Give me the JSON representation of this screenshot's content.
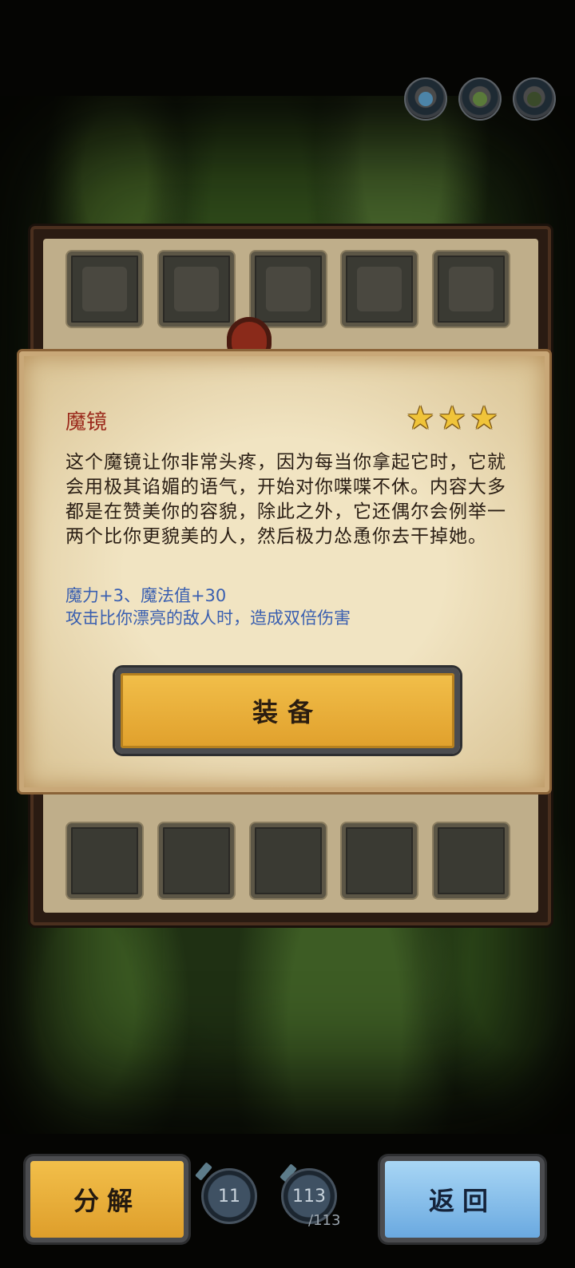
{
  "header": {
    "avatars": [
      {
        "name": "hero-avatar-1",
        "color": "#4c84a8"
      },
      {
        "name": "hero-avatar-2",
        "color": "#5a7a3a"
      },
      {
        "name": "hero-avatar-3",
        "color": "#3a4a2a"
      }
    ]
  },
  "item": {
    "name": "魔镜",
    "stars": 3,
    "description": "这个魔镜让你非常头疼，因为每当你拿起它时，它就会用极其谄媚的语气，开始对你喋喋不休。内容大多都是在赞美你的容貌，除此之外，它还偶尔会例举一两个比你更貌美的人，然后极力怂恿你去干掉她。",
    "effect_stats": "魔力+3、魔法值+30",
    "effect_special": "攻击比你漂亮的敌人时，造成双倍伤害",
    "equip_label": "装备"
  },
  "bottom": {
    "decompose_label": "分解",
    "back_label": "返回",
    "counter_a": "11",
    "counter_b": "113",
    "counter_b_max": "/113"
  },
  "colors": {
    "title": "#9b2a1c",
    "effect": "#3a5fb0",
    "gold_button": "#e8ad36",
    "blue_button": "#7ab5e6"
  }
}
